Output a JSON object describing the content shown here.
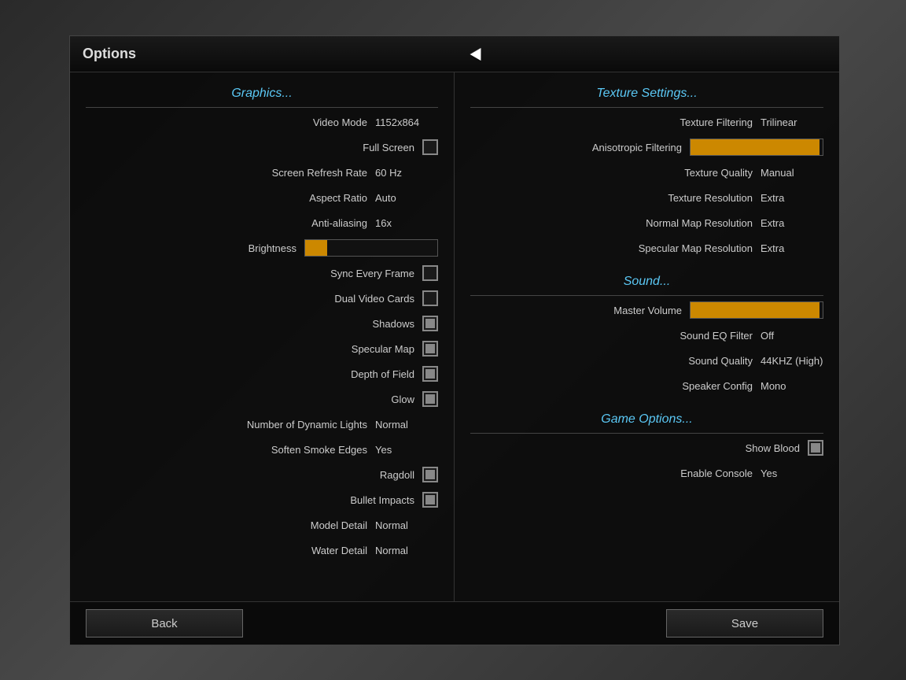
{
  "window": {
    "title": "Options"
  },
  "graphics": {
    "section_title": "Graphics...",
    "video_mode_label": "Video Mode",
    "video_mode_value": "1152x864",
    "fullscreen_label": "Full Screen",
    "fullscreen_checked": false,
    "refresh_rate_label": "Screen Refresh Rate",
    "refresh_rate_value": "60 Hz",
    "aspect_ratio_label": "Aspect Ratio",
    "aspect_ratio_value": "Auto",
    "anti_aliasing_label": "Anti-aliasing",
    "anti_aliasing_value": "16x",
    "brightness_label": "Brightness",
    "sync_frame_label": "Sync Every Frame",
    "sync_frame_checked": false,
    "dual_video_label": "Dual Video Cards",
    "dual_video_checked": false,
    "shadows_label": "Shadows",
    "shadows_checked": true,
    "specular_map_label": "Specular Map",
    "specular_map_checked": true,
    "depth_of_field_label": "Depth of Field",
    "depth_of_field_checked": true,
    "glow_label": "Glow",
    "glow_checked": true,
    "dynamic_lights_label": "Number of Dynamic Lights",
    "dynamic_lights_value": "Normal",
    "smoke_edges_label": "Soften Smoke Edges",
    "smoke_edges_value": "Yes",
    "ragdoll_label": "Ragdoll",
    "ragdoll_checked": true,
    "bullet_impacts_label": "Bullet Impacts",
    "bullet_impacts_checked": true,
    "model_detail_label": "Model Detail",
    "model_detail_value": "Normal",
    "water_detail_label": "Water Detail",
    "water_detail_value": "Normal"
  },
  "texture": {
    "section_title": "Texture Settings...",
    "filtering_label": "Texture Filtering",
    "filtering_value": "Trilinear",
    "aniso_label": "Anisotropic Filtering",
    "quality_label": "Texture Quality",
    "quality_value": "Manual",
    "resolution_label": "Texture Resolution",
    "resolution_value": "Extra",
    "normal_map_label": "Normal Map Resolution",
    "normal_map_value": "Extra",
    "specular_map_label": "Specular Map Resolution",
    "specular_map_value": "Extra"
  },
  "sound": {
    "section_title": "Sound...",
    "master_volume_label": "Master Volume",
    "eq_filter_label": "Sound EQ Filter",
    "eq_filter_value": "Off",
    "quality_label": "Sound Quality",
    "quality_value": "44KHZ (High)",
    "speaker_label": "Speaker Config",
    "speaker_value": "Mono"
  },
  "game": {
    "section_title": "Game Options...",
    "show_blood_label": "Show Blood",
    "show_blood_checked": true,
    "console_label": "Enable Console",
    "console_value": "Yes"
  },
  "buttons": {
    "back": "Back",
    "save": "Save"
  }
}
